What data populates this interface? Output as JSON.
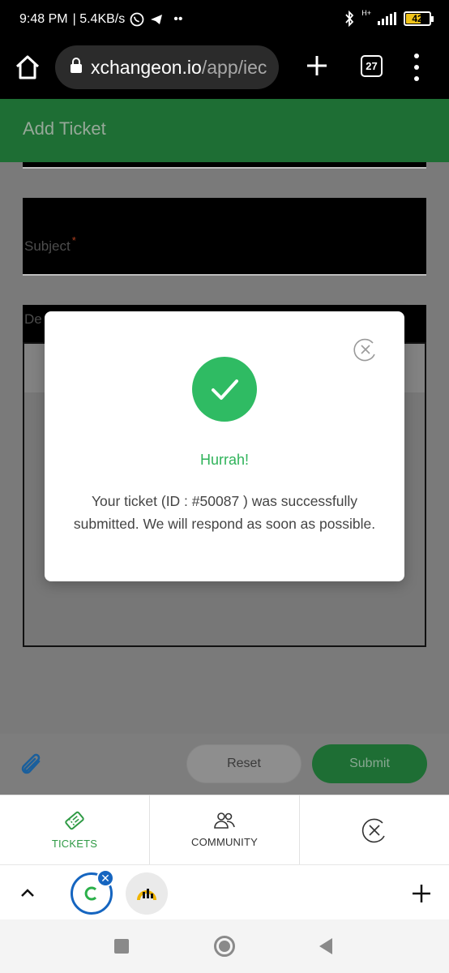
{
  "status_bar": {
    "time": "9:48 PM",
    "speed": "| 5.4KB/s",
    "more": "••",
    "signal_type": "H+",
    "battery": "42"
  },
  "browser": {
    "url_host": "xchangeon.io",
    "url_path": "/app/iec",
    "tab_count": "27"
  },
  "page": {
    "title": "Add Ticket"
  },
  "form": {
    "subject_label": "Subject",
    "required_mark": "*",
    "description_label": "De"
  },
  "actions": {
    "reset_label": "Reset",
    "submit_label": "Submit"
  },
  "bottom_tabs": [
    {
      "label": "TICKETS"
    },
    {
      "label": "COMMUNITY"
    }
  ],
  "modal": {
    "title": "Hurrah!",
    "message": "Your ticket (ID : #50087 ) was successfully submitted. We will respond as soon as possible."
  },
  "colors": {
    "brand_green": "#1e6e34",
    "success_green": "#2fbb63",
    "tab_active": "#2f9a45",
    "link_blue": "#1565c0"
  }
}
